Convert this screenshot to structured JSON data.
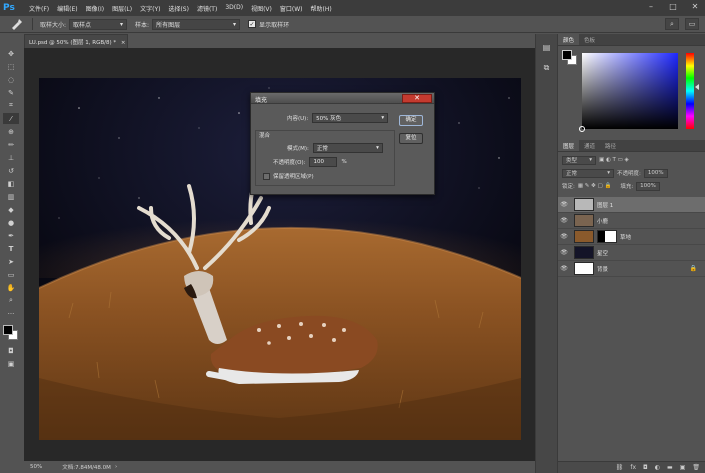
{
  "app": {
    "logo": "Ps"
  },
  "menu": [
    "文件(F)",
    "编辑(E)",
    "图像(I)",
    "图层(L)",
    "文字(Y)",
    "选择(S)",
    "滤镜(T)",
    "3D(D)",
    "视图(V)",
    "窗口(W)",
    "帮助(H)"
  ],
  "window_controls": {
    "minimize": "–",
    "maximize": "□",
    "close": "✕"
  },
  "options": {
    "sample_size_label": "取样大小:",
    "sample_size_value": "取样点",
    "sample_label": "样本:",
    "sample_value": "所有图层",
    "show_ring_label": "显示取样环",
    "show_ring_checked": true
  },
  "document": {
    "tab_title": "LU.psd @ 50% (图层 1, RGB/8) *",
    "tab_close": "×",
    "zoom": "50%",
    "doc_info": "文档:7.84M/48.0M"
  },
  "fill_dialog": {
    "title": "填充",
    "content_label": "内容(U):",
    "content_value": "50% 灰色",
    "blending_label": "混合",
    "mode_label": "模式(M):",
    "mode_value": "正常",
    "opacity_label": "不透明度(O):",
    "opacity_value": "100",
    "opacity_unit": "%",
    "preserve_label": "保留透明区域(P)",
    "ok_button": "确定",
    "reset_button": "复位",
    "close": "✕"
  },
  "color_panel": {
    "tabs": [
      "颜色",
      "色板"
    ]
  },
  "layers_panel": {
    "tabs": [
      "图层",
      "通道",
      "路径"
    ],
    "kind_value": "类型",
    "blend_value": "正常",
    "opacity_label": "不透明度:",
    "opacity_value": "100%",
    "lock_label": "锁定:",
    "fill_label": "填充:",
    "fill_value": "100%",
    "layers": [
      {
        "name": "图层 1",
        "selected": true,
        "thumb": "#b8b8b8",
        "locked": false
      },
      {
        "name": "小鹿",
        "selected": false,
        "thumb": "#7a6450",
        "locked": false
      },
      {
        "name": "草地",
        "selected": false,
        "thumb": "#8a5a2c",
        "locked": false
      },
      {
        "name": "星空",
        "selected": false,
        "thumb": "#141428",
        "locked": false
      },
      {
        "name": "背景",
        "selected": false,
        "thumb": "#ffffff",
        "locked": true
      }
    ],
    "footer_icons": [
      "link-icon",
      "fx-icon",
      "mask-icon",
      "adjustment-icon",
      "folder-icon",
      "new-layer-icon",
      "trash-icon"
    ]
  },
  "colors": {
    "accent": "#31a8ff",
    "close_red": "#c43a2f"
  }
}
